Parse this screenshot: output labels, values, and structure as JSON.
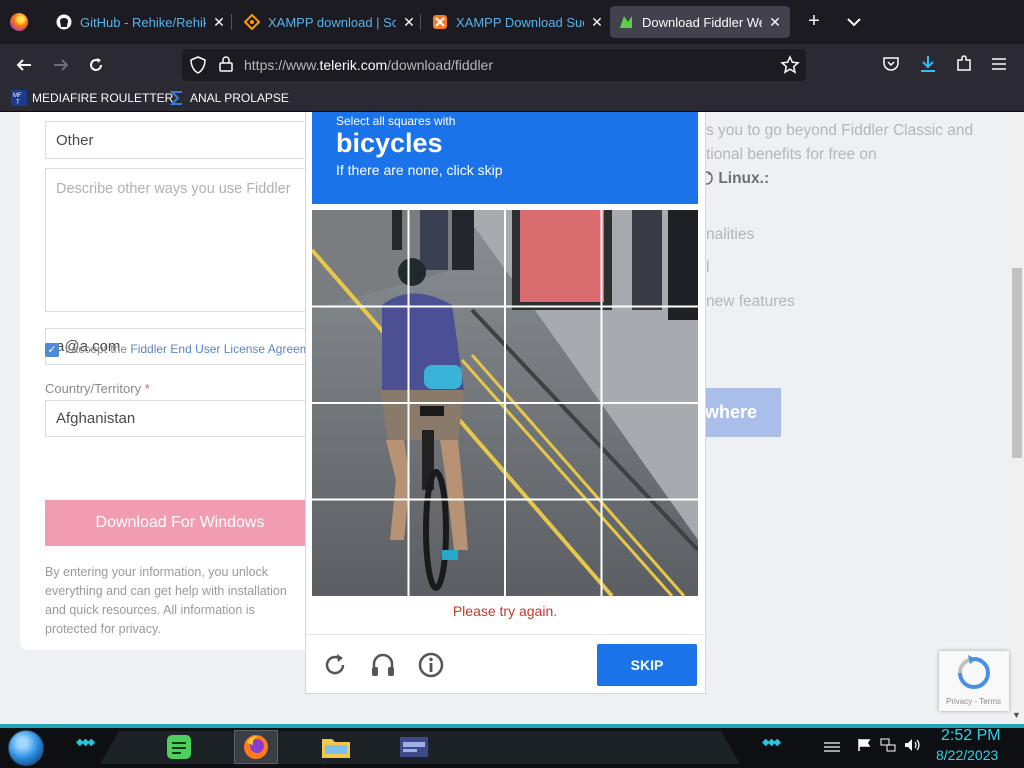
{
  "browser": {
    "tabs": [
      {
        "label": "GitHub - Rehike/Rehike: Rehike",
        "icon": "github-icon"
      },
      {
        "label": "XAMPP download | SourceForge",
        "icon": "sourceforge-icon"
      },
      {
        "label": "XAMPP Download Success",
        "icon": "xampp-icon"
      },
      {
        "label": "Download Fiddler Web Debugging",
        "icon": "fiddler-icon",
        "active": true
      }
    ],
    "url_prefix": "https://www.",
    "url_domain": "telerik.com",
    "url_path": "/download/fiddler",
    "bookmarks": [
      {
        "label": "MEDIAFIRE ROULETTER",
        "icon": "mediafire-icon"
      },
      {
        "label": "ANAL PROLAPSE",
        "icon": "sigma-icon"
      }
    ]
  },
  "form": {
    "use_value": "Other",
    "describe_placeholder": "Describe other ways you use Fiddler",
    "email_value": "a@a.com",
    "country_label": "Country/Territory",
    "country_required": "*",
    "country_value": "Afghanistan",
    "accept_text": "I accept the ",
    "accept_link": "Fiddler End User License Agreement",
    "download_button": "Download For Windows",
    "fineprint": "By entering your information, you unlock everything and can get help with installation and quick resources. All information is protected for privacy."
  },
  "right_panel": {
    "line1": "s you to go beyond Fiddler Classic and",
    "line2": "tional benefits for free on",
    "line3": "Linux.:",
    "item1": "nalities",
    "item2": "l",
    "item3": "new features",
    "button": "where"
  },
  "captcha": {
    "instruction": "Select all squares with",
    "target": "bicycles",
    "hint": "If there are none, click skip",
    "error": "Please try again.",
    "skip_button": "SKIP",
    "grid_size": 4
  },
  "recaptcha": {
    "privacy": "Privacy",
    "terms": "Terms",
    "separator": " - "
  },
  "taskbar": {
    "time": "2:52 PM",
    "date": "8/22/2023"
  },
  "colors": {
    "accent_blue": "#1a73e8",
    "error_red": "#c5392b",
    "clock_cyan": "#2ed3e6"
  }
}
